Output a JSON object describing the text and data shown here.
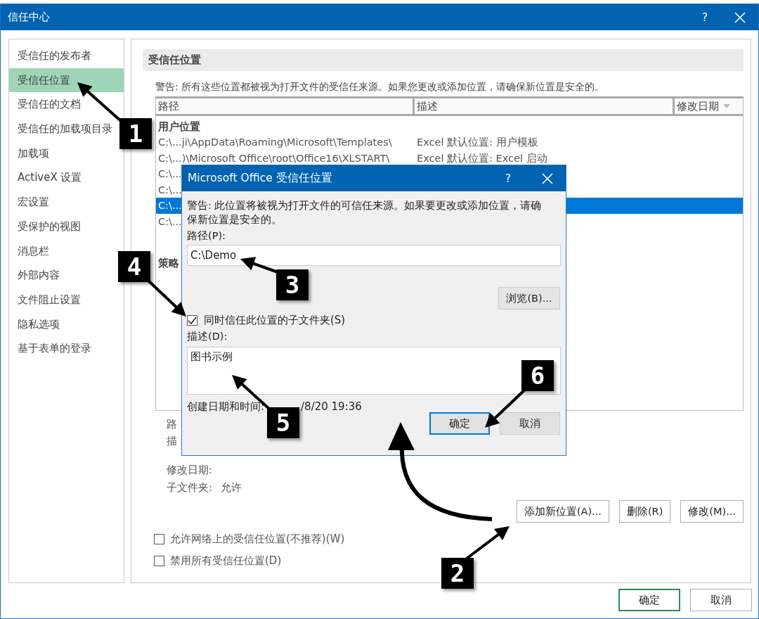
{
  "window": {
    "title": "信任中心",
    "help": "?"
  },
  "sidebar": {
    "items": [
      {
        "label": "受信任的发布者",
        "selected": false
      },
      {
        "label": "受信任位置",
        "selected": true
      },
      {
        "label": "受信任的文档",
        "selected": false
      },
      {
        "label": "受信任的加载项目录",
        "selected": false
      },
      {
        "label": "加载项",
        "selected": false
      },
      {
        "label": "ActiveX 设置",
        "selected": false
      },
      {
        "label": "宏设置",
        "selected": false
      },
      {
        "label": "受保护的视图",
        "selected": false
      },
      {
        "label": "消息栏",
        "selected": false
      },
      {
        "label": "外部内容",
        "selected": false
      },
      {
        "label": "文件阻止设置",
        "selected": false
      },
      {
        "label": "隐私选项",
        "selected": false
      },
      {
        "label": "基于表单的登录",
        "selected": false
      }
    ]
  },
  "section": {
    "title": "受信任位置",
    "warning": "警告: 所有这些位置都被视为打开文件的受信任来源。如果您更改或添加位置，请确保新位置是安全的。"
  },
  "table": {
    "columns": [
      {
        "label": "路径",
        "sort": false
      },
      {
        "label": "描述",
        "sort": false
      },
      {
        "label": "修改日期",
        "sort": true
      }
    ],
    "rows": [
      {
        "kind": "group",
        "path": "用户位置"
      },
      {
        "kind": "row",
        "path": "C:\\...ji\\AppData\\Roaming\\Microsoft\\Templates\\",
        "description": "Excel 默认位置: 用户模板",
        "selected": false
      },
      {
        "kind": "row",
        "path": "C:\\...)\\Microsoft Office\\root\\Office16\\XLSTART\\",
        "description": "Excel 默认位置: Excel 启动",
        "selected": false
      },
      {
        "kind": "row",
        "path": "C:\\...",
        "selected": false
      },
      {
        "kind": "row",
        "path": "C:\\...",
        "selected": false
      },
      {
        "kind": "row",
        "path": "C:\\...",
        "selected": true
      },
      {
        "kind": "row",
        "path": "C:\\...",
        "selected": false
      },
      {
        "kind": "group",
        "path": "策略"
      }
    ]
  },
  "details": [
    {
      "label": "路"
    },
    {
      "label": "描"
    }
  ],
  "info": [
    {
      "label": "修改日期:"
    },
    {
      "label": "子文件夹:",
      "value": "允许"
    }
  ],
  "buttons": [
    "添加新位置(A)...",
    "删除(R)",
    "修改(M)..."
  ],
  "options": [
    {
      "label": "允许网络上的受信任位置(不推荐)(W)",
      "checked": false
    },
    {
      "label": "禁用所有受信任位置(D)",
      "checked": false
    }
  ],
  "footer_buttons": [
    {
      "label": "确定",
      "default": true
    },
    {
      "label": "取消",
      "default": false
    }
  ],
  "dialog": {
    "title": "Microsoft Office 受信任位置",
    "help": "?",
    "warning": "警告: 此位置将被视为打开文件的可信任来源。如果要更改或添加位置，请确保新位置是安全的。",
    "path_label": "路径(P):",
    "path_value": "C:\\Demo",
    "browse": "浏览(B)...",
    "subfolders": {
      "label": "同时信任此位置的子文件夹(S)",
      "checked": true
    },
    "desc_label": "描述(D):",
    "desc_value": "图书示例",
    "created_label": "创建日期和时间:",
    "created_value": "/8/20 19:36",
    "buttons": [
      {
        "label": "确定",
        "focused": true
      },
      {
        "label": "取消",
        "focused": false
      }
    ]
  },
  "annotations": [
    {
      "label": "1"
    },
    {
      "label": "2"
    },
    {
      "label": "3"
    },
    {
      "label": "4"
    },
    {
      "label": "5"
    },
    {
      "label": "6"
    }
  ]
}
